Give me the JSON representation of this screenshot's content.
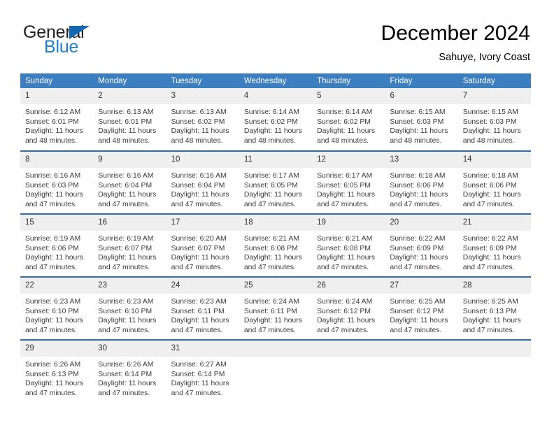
{
  "brand": {
    "word_top": "General",
    "word_bottom": "Blue",
    "triangle_color": "#1268b3",
    "blue_color": "#1c7fd4"
  },
  "header": {
    "title": "December 2024",
    "subtitle": "Sahuye, Ivory Coast"
  },
  "theme": {
    "header_bg": "#3c7fc1",
    "row_rule": "#2f6fad",
    "daynum_bg": "#efefef"
  },
  "weekdays": [
    "Sunday",
    "Monday",
    "Tuesday",
    "Wednesday",
    "Thursday",
    "Friday",
    "Saturday"
  ],
  "weeks": [
    [
      {
        "day": "1",
        "sunrise": "Sunrise: 6:12 AM",
        "sunset": "Sunset: 6:01 PM",
        "daylight1": "Daylight: 11 hours",
        "daylight2": "and 48 minutes."
      },
      {
        "day": "2",
        "sunrise": "Sunrise: 6:13 AM",
        "sunset": "Sunset: 6:01 PM",
        "daylight1": "Daylight: 11 hours",
        "daylight2": "and 48 minutes."
      },
      {
        "day": "3",
        "sunrise": "Sunrise: 6:13 AM",
        "sunset": "Sunset: 6:02 PM",
        "daylight1": "Daylight: 11 hours",
        "daylight2": "and 48 minutes."
      },
      {
        "day": "4",
        "sunrise": "Sunrise: 6:14 AM",
        "sunset": "Sunset: 6:02 PM",
        "daylight1": "Daylight: 11 hours",
        "daylight2": "and 48 minutes."
      },
      {
        "day": "5",
        "sunrise": "Sunrise: 6:14 AM",
        "sunset": "Sunset: 6:02 PM",
        "daylight1": "Daylight: 11 hours",
        "daylight2": "and 48 minutes."
      },
      {
        "day": "6",
        "sunrise": "Sunrise: 6:15 AM",
        "sunset": "Sunset: 6:03 PM",
        "daylight1": "Daylight: 11 hours",
        "daylight2": "and 48 minutes."
      },
      {
        "day": "7",
        "sunrise": "Sunrise: 6:15 AM",
        "sunset": "Sunset: 6:03 PM",
        "daylight1": "Daylight: 11 hours",
        "daylight2": "and 48 minutes."
      }
    ],
    [
      {
        "day": "8",
        "sunrise": "Sunrise: 6:16 AM",
        "sunset": "Sunset: 6:03 PM",
        "daylight1": "Daylight: 11 hours",
        "daylight2": "and 47 minutes."
      },
      {
        "day": "9",
        "sunrise": "Sunrise: 6:16 AM",
        "sunset": "Sunset: 6:04 PM",
        "daylight1": "Daylight: 11 hours",
        "daylight2": "and 47 minutes."
      },
      {
        "day": "10",
        "sunrise": "Sunrise: 6:16 AM",
        "sunset": "Sunset: 6:04 PM",
        "daylight1": "Daylight: 11 hours",
        "daylight2": "and 47 minutes."
      },
      {
        "day": "11",
        "sunrise": "Sunrise: 6:17 AM",
        "sunset": "Sunset: 6:05 PM",
        "daylight1": "Daylight: 11 hours",
        "daylight2": "and 47 minutes."
      },
      {
        "day": "12",
        "sunrise": "Sunrise: 6:17 AM",
        "sunset": "Sunset: 6:05 PM",
        "daylight1": "Daylight: 11 hours",
        "daylight2": "and 47 minutes."
      },
      {
        "day": "13",
        "sunrise": "Sunrise: 6:18 AM",
        "sunset": "Sunset: 6:06 PM",
        "daylight1": "Daylight: 11 hours",
        "daylight2": "and 47 minutes."
      },
      {
        "day": "14",
        "sunrise": "Sunrise: 6:18 AM",
        "sunset": "Sunset: 6:06 PM",
        "daylight1": "Daylight: 11 hours",
        "daylight2": "and 47 minutes."
      }
    ],
    [
      {
        "day": "15",
        "sunrise": "Sunrise: 6:19 AM",
        "sunset": "Sunset: 6:06 PM",
        "daylight1": "Daylight: 11 hours",
        "daylight2": "and 47 minutes."
      },
      {
        "day": "16",
        "sunrise": "Sunrise: 6:19 AM",
        "sunset": "Sunset: 6:07 PM",
        "daylight1": "Daylight: 11 hours",
        "daylight2": "and 47 minutes."
      },
      {
        "day": "17",
        "sunrise": "Sunrise: 6:20 AM",
        "sunset": "Sunset: 6:07 PM",
        "daylight1": "Daylight: 11 hours",
        "daylight2": "and 47 minutes."
      },
      {
        "day": "18",
        "sunrise": "Sunrise: 6:21 AM",
        "sunset": "Sunset: 6:08 PM",
        "daylight1": "Daylight: 11 hours",
        "daylight2": "and 47 minutes."
      },
      {
        "day": "19",
        "sunrise": "Sunrise: 6:21 AM",
        "sunset": "Sunset: 6:08 PM",
        "daylight1": "Daylight: 11 hours",
        "daylight2": "and 47 minutes."
      },
      {
        "day": "20",
        "sunrise": "Sunrise: 6:22 AM",
        "sunset": "Sunset: 6:09 PM",
        "daylight1": "Daylight: 11 hours",
        "daylight2": "and 47 minutes."
      },
      {
        "day": "21",
        "sunrise": "Sunrise: 6:22 AM",
        "sunset": "Sunset: 6:09 PM",
        "daylight1": "Daylight: 11 hours",
        "daylight2": "and 47 minutes."
      }
    ],
    [
      {
        "day": "22",
        "sunrise": "Sunrise: 6:23 AM",
        "sunset": "Sunset: 6:10 PM",
        "daylight1": "Daylight: 11 hours",
        "daylight2": "and 47 minutes."
      },
      {
        "day": "23",
        "sunrise": "Sunrise: 6:23 AM",
        "sunset": "Sunset: 6:10 PM",
        "daylight1": "Daylight: 11 hours",
        "daylight2": "and 47 minutes."
      },
      {
        "day": "24",
        "sunrise": "Sunrise: 6:23 AM",
        "sunset": "Sunset: 6:11 PM",
        "daylight1": "Daylight: 11 hours",
        "daylight2": "and 47 minutes."
      },
      {
        "day": "25",
        "sunrise": "Sunrise: 6:24 AM",
        "sunset": "Sunset: 6:11 PM",
        "daylight1": "Daylight: 11 hours",
        "daylight2": "and 47 minutes."
      },
      {
        "day": "26",
        "sunrise": "Sunrise: 6:24 AM",
        "sunset": "Sunset: 6:12 PM",
        "daylight1": "Daylight: 11 hours",
        "daylight2": "and 47 minutes."
      },
      {
        "day": "27",
        "sunrise": "Sunrise: 6:25 AM",
        "sunset": "Sunset: 6:12 PM",
        "daylight1": "Daylight: 11 hours",
        "daylight2": "and 47 minutes."
      },
      {
        "day": "28",
        "sunrise": "Sunrise: 6:25 AM",
        "sunset": "Sunset: 6:13 PM",
        "daylight1": "Daylight: 11 hours",
        "daylight2": "and 47 minutes."
      }
    ],
    [
      {
        "day": "29",
        "sunrise": "Sunrise: 6:26 AM",
        "sunset": "Sunset: 6:13 PM",
        "daylight1": "Daylight: 11 hours",
        "daylight2": "and 47 minutes."
      },
      {
        "day": "30",
        "sunrise": "Sunrise: 6:26 AM",
        "sunset": "Sunset: 6:14 PM",
        "daylight1": "Daylight: 11 hours",
        "daylight2": "and 47 minutes."
      },
      {
        "day": "31",
        "sunrise": "Sunrise: 6:27 AM",
        "sunset": "Sunset: 6:14 PM",
        "daylight1": "Daylight: 11 hours",
        "daylight2": "and 47 minutes."
      },
      {
        "day": "",
        "sunrise": "",
        "sunset": "",
        "daylight1": "",
        "daylight2": ""
      },
      {
        "day": "",
        "sunrise": "",
        "sunset": "",
        "daylight1": "",
        "daylight2": ""
      },
      {
        "day": "",
        "sunrise": "",
        "sunset": "",
        "daylight1": "",
        "daylight2": ""
      },
      {
        "day": "",
        "sunrise": "",
        "sunset": "",
        "daylight1": "",
        "daylight2": ""
      }
    ]
  ]
}
